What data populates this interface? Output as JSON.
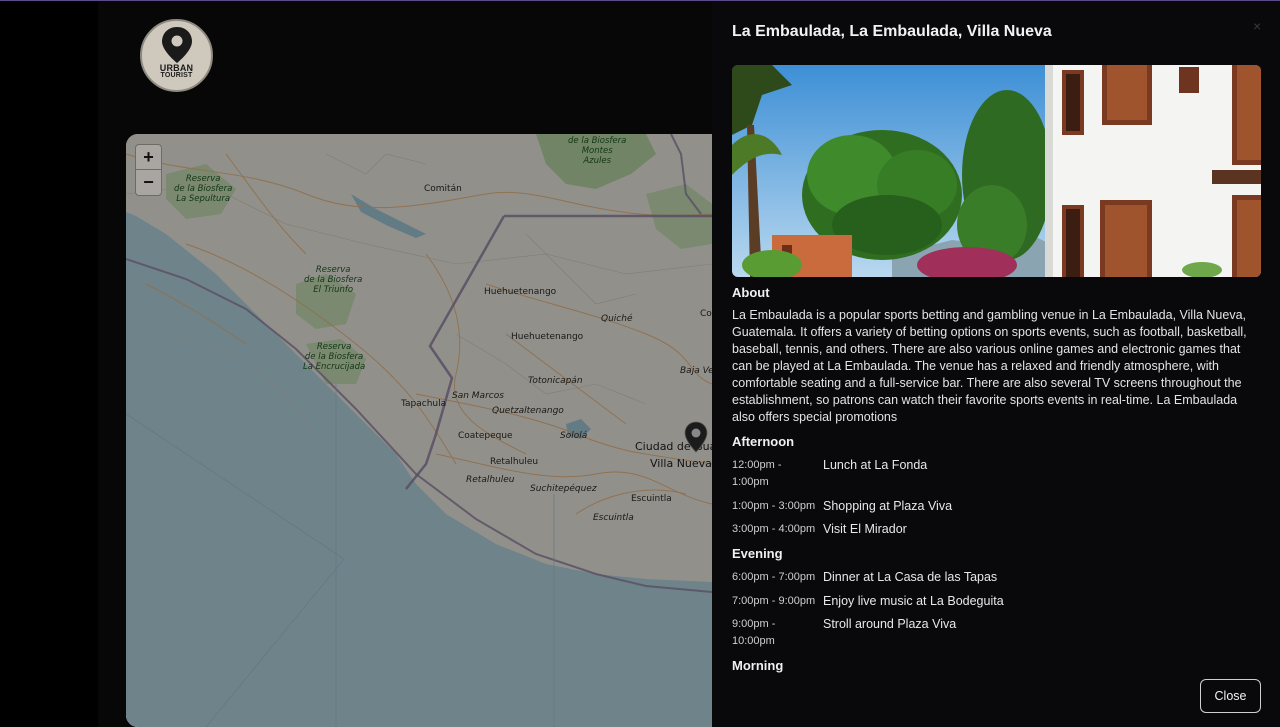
{
  "logo": {
    "line1": "URBAN",
    "line2": "TOURIST"
  },
  "map": {
    "zoom_in": "+",
    "zoom_out": "−",
    "labels": {
      "reserva_sepultura": "Reserva\nde la Biosfera\nLa Sepultura",
      "reserva_triunfo": "Reserva\nde la Biosfera\nEl Triunfo",
      "reserva_encrucijada": "Reserva\nde la Biosfera\nLa Encrucijada",
      "reserva_montes": "de la Biosfera\nMontes\nAzules",
      "comitan": "Comitán",
      "huehuetenango1": "Huehuetenango",
      "huehuetenango2": "Huehuetenango",
      "quiche": "Quiché",
      "tapachula": "Tapachula",
      "san_marcos": "San Marcos",
      "totonicapan": "Totonicapán",
      "quetzaltenango": "Quetzaltenango",
      "coatepeque": "Coatepeque",
      "solola": "Sololá",
      "retalhuleu1": "Retalhuleu",
      "retalhuleu2": "Retalhuleu",
      "suchitepequez": "Suchitepéquez",
      "escuintla1": "Escuintla",
      "escuintla2": "Escuintla",
      "ciudad": "Ciudad de Gua",
      "villa_nueva": "Villa Nueva",
      "baja_ve": "Baja Ve",
      "col": "Col"
    }
  },
  "panel": {
    "title": "La Embaulada, La Embaulada, Villa Nueva",
    "close_x": "×",
    "about_heading": "About",
    "about_text": "La Embaulada is a popular sports betting and gambling venue in La Embaulada, Villa Nueva, Guatemala. It offers a variety of betting options on sports events, such as football, basketball, baseball, tennis, and others. There are also various online games and electronic games that can be played at La Embaulada. The venue has a relaxed and friendly atmosphere, with comfortable seating and a full-service bar. There are also several TV screens throughout the establishment, so patrons can watch their favorite sports events in real-time. La Embaulada also offers special promotions",
    "afternoon_heading": "Afternoon",
    "afternoon": [
      {
        "time": "12:00pm - 1:00pm",
        "activity": "Lunch at La Fonda"
      },
      {
        "time": "1:00pm - 3:00pm",
        "activity": "Shopping at Plaza Viva"
      },
      {
        "time": "3:00pm - 4:00pm",
        "activity": "Visit El Mirador"
      }
    ],
    "evening_heading": "Evening",
    "evening": [
      {
        "time": "6:00pm - 7:00pm",
        "activity": "Dinner at La Casa de las Tapas"
      },
      {
        "time": "7:00pm - 9:00pm",
        "activity": "Enjoy live music at La Bodeguita"
      },
      {
        "time": "9:00pm - 10:00pm",
        "activity": "Stroll around Plaza Viva"
      }
    ],
    "morning_heading": "Morning",
    "close_button": "Close"
  }
}
